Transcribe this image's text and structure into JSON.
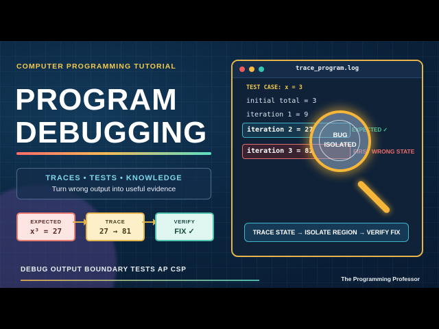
{
  "header": {
    "kicker": "COMPUTER PROGRAMMING TUTORIAL",
    "title_line1": "PROGRAM",
    "title_line2": "DEBUGGING"
  },
  "info_box": {
    "headline": "TRACES • TESTS • KNOWLEDGE",
    "subline": "Turn wrong output into useful evidence"
  },
  "steps": [
    {
      "label": "EXPECTED",
      "value": "x³ = 27"
    },
    {
      "label": "TRACE",
      "value": "27 → 81"
    },
    {
      "label": "VERIFY",
      "value": "FIX ✓"
    }
  ],
  "footer": {
    "tags": "DEBUG OUTPUT BOUNDARY TESTS AP CSP",
    "credit": "The Programming Professor"
  },
  "log_window": {
    "title": "trace_program.log",
    "test_case": "TEST CASE: x = 3",
    "lines": [
      "initial total = 3",
      "iteration 1 = 9"
    ],
    "iteration2": "iteration 2 = 27",
    "iteration3": "iteration 3 = 81",
    "expected_note": "EXPECTED ✓",
    "wrong_note": "FIRST WRONG STATE",
    "lens_line1": "BUG",
    "lens_line2": "ISOLATED",
    "process": "TRACE STATE → ISOLATE REGION → VERIFY FIX"
  },
  "colors": {
    "accent_gold": "#f5b63a",
    "accent_teal": "#3fb6c9",
    "error_red": "#e56e6e",
    "background": "#0b2540"
  },
  "icons": [
    "magnifying-glass-icon",
    "check-icon",
    "arrow-right-icon",
    "window-control-dots"
  ]
}
